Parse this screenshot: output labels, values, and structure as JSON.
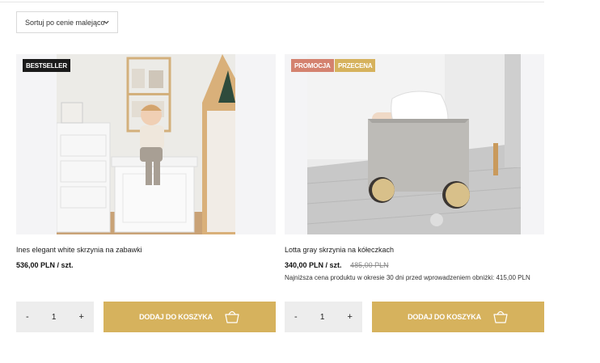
{
  "sort": {
    "label": "Sortuj po cenie malejąco"
  },
  "products": [
    {
      "name": "Ines elegant white skrzynia na zabawki",
      "price": "536,00 PLN / szt.",
      "badges": [
        "BESTSELLER"
      ],
      "quantity": "1",
      "add_to_cart": "DODAJ DO KOSZYKA"
    },
    {
      "name": "Lotta gray skrzynia na kółeczkach",
      "price": "340,00 PLN / szt.",
      "old_price": "485,00 PLN",
      "lowest_price_note": "Najniższa cena produktu w okresie 30 dni przed wprowadzeniem obniżki: 415,00 PLN",
      "badges": [
        "PROMOCJA",
        "PRZECENA"
      ],
      "quantity": "1",
      "add_to_cart": "DODAJ DO KOSZYKA"
    }
  ],
  "qty_controls": {
    "minus": "-",
    "plus": "+"
  },
  "colors": {
    "accent": "#d6b25d",
    "promo": "#d4826f",
    "bestseller": "#1b1b1b"
  }
}
